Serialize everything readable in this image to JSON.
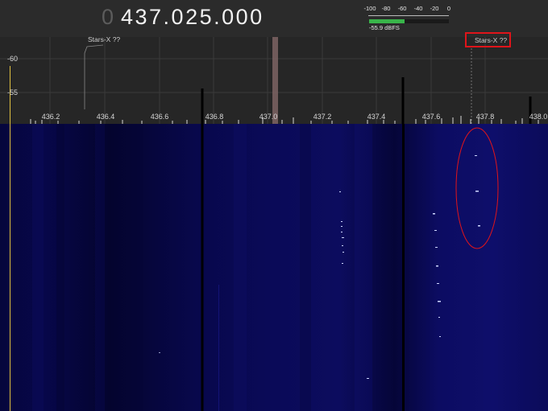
{
  "frequency": {
    "leading": "0",
    "main": "437.025.000"
  },
  "level_meter": {
    "scale": [
      "-100",
      "-80",
      "-60",
      "-40",
      "-20",
      "0"
    ],
    "readout": "-55.9 dBFS",
    "level_fraction": 0.44,
    "fill_color": "#39b54a"
  },
  "spectrum": {
    "y_labels": [
      "-60",
      "-55"
    ],
    "x_labels": [
      "436.2",
      "436.4",
      "436.6",
      "436.8",
      "437.0",
      "437.2",
      "437.4",
      "437.6",
      "437.8",
      "438.0"
    ]
  },
  "satellites": [
    {
      "label": "Stars-X ??"
    },
    {
      "label": "Stars-X ??",
      "highlighted": true
    }
  ],
  "colors": {
    "background": "#262626",
    "waterfall": "#0a0a4a",
    "annotation": "#e0141a",
    "meter_fill": "#39b54a"
  }
}
